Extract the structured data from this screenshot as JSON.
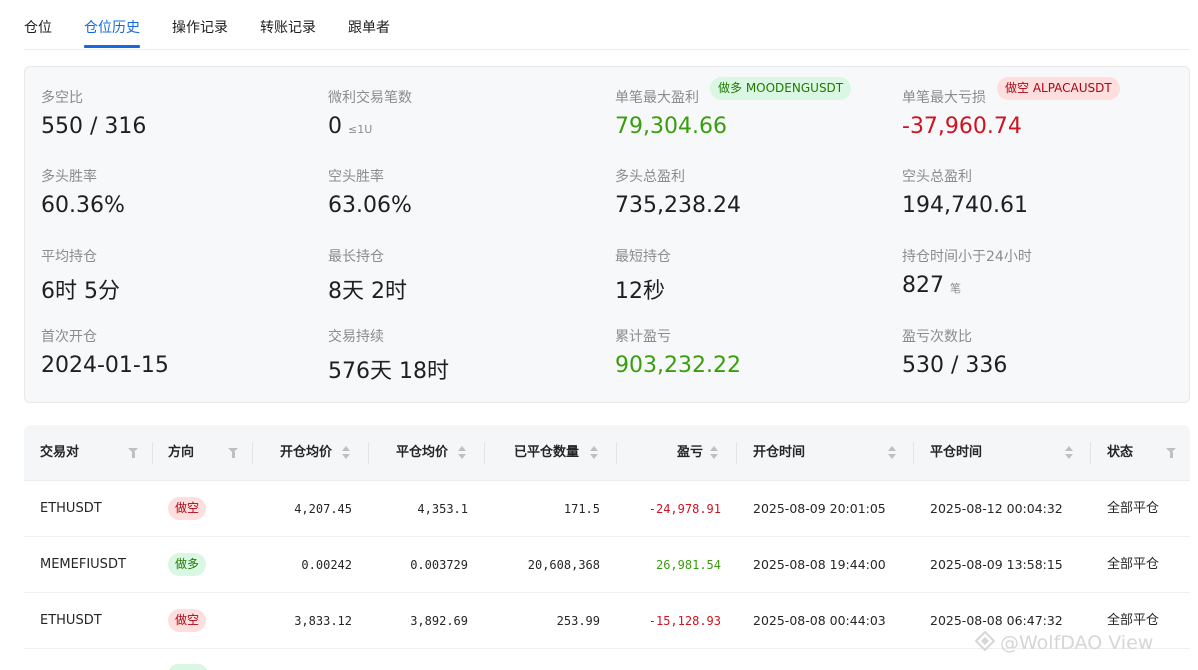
{
  "tabs": [
    {
      "label": "仓位"
    },
    {
      "label": "仓位历史"
    },
    {
      "label": "操作记录"
    },
    {
      "label": "转账记录"
    },
    {
      "label": "跟单者"
    }
  ],
  "active_tab": "仓位历史",
  "stats": {
    "long_short_ratio": {
      "label": "多空比",
      "value": "550 / 316"
    },
    "micro_trades": {
      "label": "微利交易笔数",
      "value": "0",
      "suffix": "≤1U"
    },
    "max_profit": {
      "label": "单笔最大盈利",
      "value": "79,304.66",
      "tag": "做多 MOODENGUSDT"
    },
    "max_loss": {
      "label": "单笔最大亏损",
      "value": "-37,960.74",
      "tag": "做空 ALPACAUSDT"
    },
    "long_win_rate": {
      "label": "多头胜率",
      "value": "60.36%"
    },
    "short_win_rate": {
      "label": "空头胜率",
      "value": "63.06%"
    },
    "long_total_profit": {
      "label": "多头总盈利",
      "value": "735,238.24"
    },
    "short_total_profit": {
      "label": "空头总盈利",
      "value": "194,740.61"
    },
    "avg_hold": {
      "label": "平均持仓",
      "value": "6时 5分"
    },
    "max_hold": {
      "label": "最长持仓",
      "value": "8天 2时"
    },
    "min_hold": {
      "label": "最短持仓",
      "value": "12秒"
    },
    "hold_under_24h": {
      "label": "持仓时间小于24小时",
      "value": "827",
      "suffix": "笔"
    },
    "first_open": {
      "label": "首次开仓",
      "value": "2024-01-15"
    },
    "trade_duration": {
      "label": "交易持续",
      "value": "576天 18时"
    },
    "cumulative_pnl": {
      "label": "累计盈亏",
      "value": "903,232.22"
    },
    "win_loss_count": {
      "label": "盈亏次数比",
      "value": "530 / 336"
    }
  },
  "table": {
    "columns": [
      "交易对",
      "方向",
      "开仓均价",
      "平仓均价",
      "已平仓数量",
      "盈亏",
      "开仓时间",
      "平仓时间",
      "状态"
    ],
    "rows": [
      {
        "pair": "ETHUSDT",
        "direction": "做空",
        "open_avg": "4,207.45",
        "close_avg": "4,353.1",
        "closed_qty": "171.5",
        "pnl": "-24,978.91",
        "open_time": "2025-08-09 20:01:05",
        "close_time": "2025-08-12 00:04:32",
        "status": "全部平仓"
      },
      {
        "pair": "MEMEFIUSDT",
        "direction": "做多",
        "open_avg": "0.00242",
        "close_avg": "0.003729",
        "closed_qty": "20,608,368",
        "pnl": "26,981.54",
        "open_time": "2025-08-08 19:44:00",
        "close_time": "2025-08-09 13:58:15",
        "status": "全部平仓"
      },
      {
        "pair": "ETHUSDT",
        "direction": "做空",
        "open_avg": "3,833.12",
        "close_avg": "3,892.69",
        "closed_qty": "253.99",
        "pnl": "-15,128.93",
        "open_time": "2025-08-08 00:44:03",
        "close_time": "2025-08-08 06:47:32",
        "status": "全部平仓"
      }
    ]
  },
  "watermark": "@WolfDAO View",
  "colors": {
    "accent": "#1668dc",
    "profit": "#389e0d",
    "loss": "#cf1322"
  }
}
